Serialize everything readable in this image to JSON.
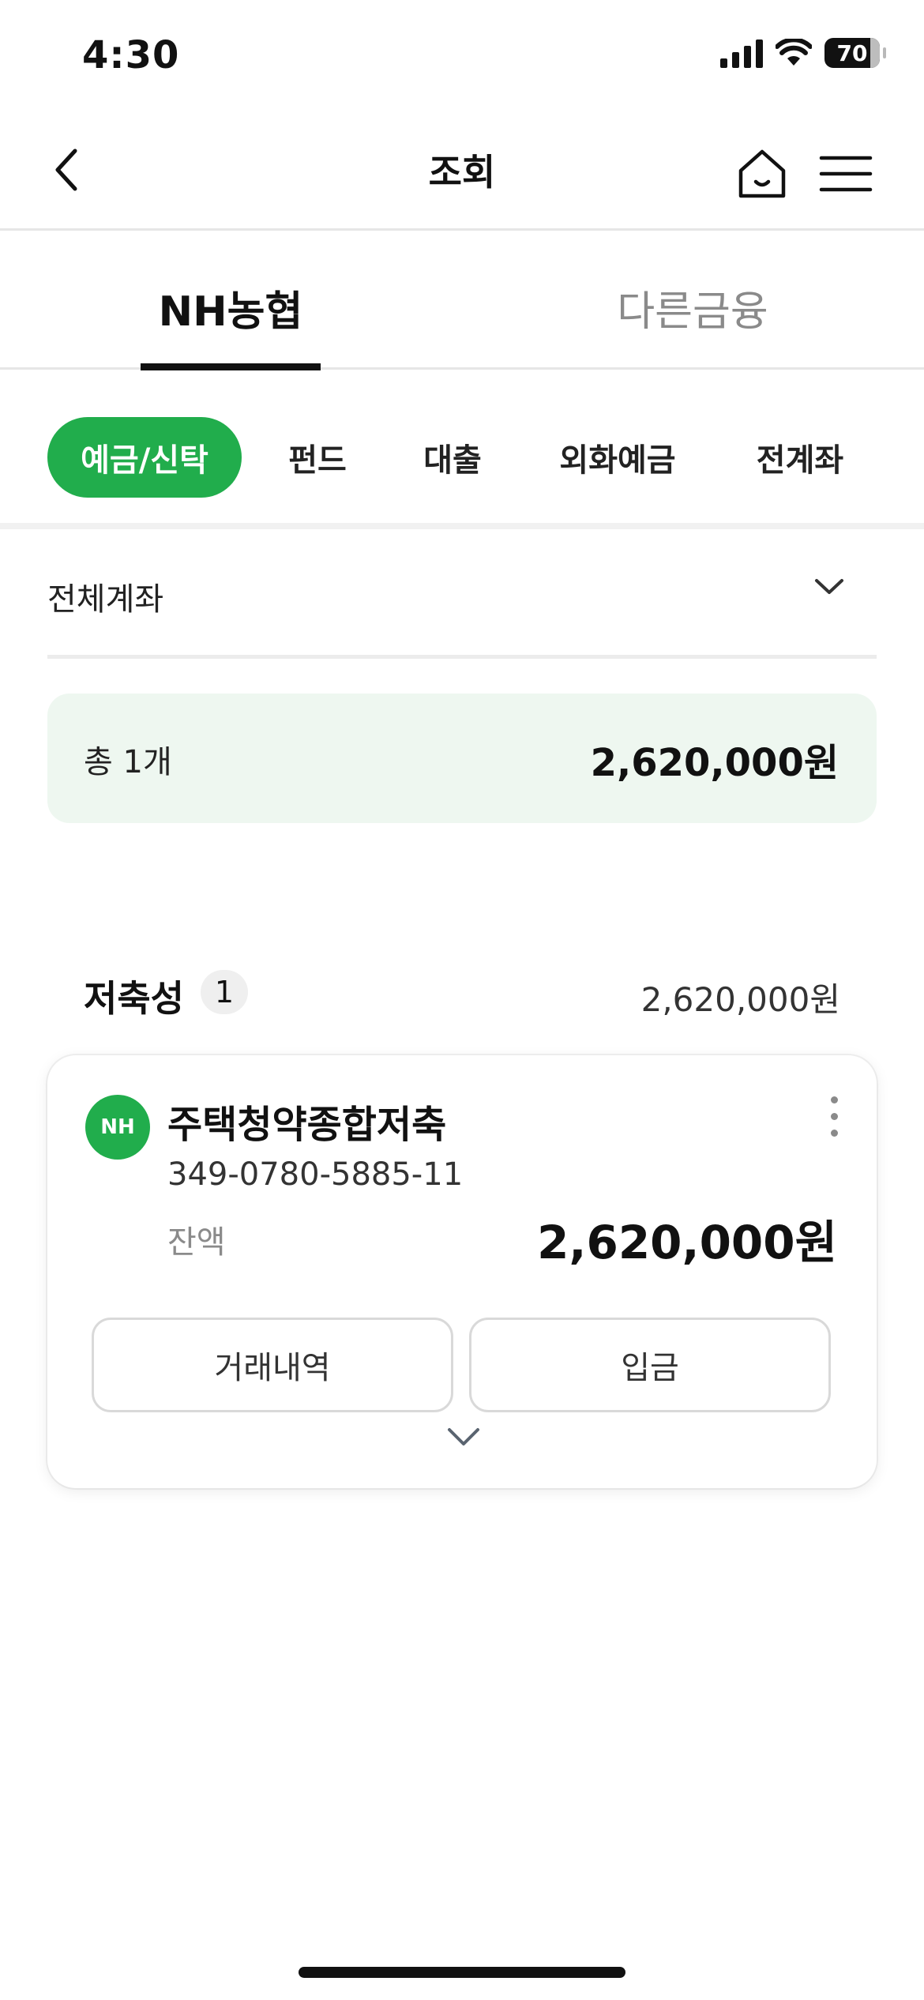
{
  "status_bar": {
    "time": "4:30",
    "battery_level": "70",
    "icons": [
      "cellular-signal-icon",
      "wifi-icon",
      "battery-icon"
    ]
  },
  "header": {
    "title": "조회",
    "back_icon": "chevron-left-icon",
    "home_icon": "home-icon",
    "menu_icon": "hamburger-menu-icon"
  },
  "top_tabs": [
    {
      "label": "NH농협",
      "active": true
    },
    {
      "label": "다른금융",
      "active": false
    }
  ],
  "category_chips": [
    {
      "label": "예금/신탁",
      "active": true
    },
    {
      "label": "펀드",
      "active": false
    },
    {
      "label": "대출",
      "active": false
    },
    {
      "label": "외화예금",
      "active": false
    },
    {
      "label": "전계좌",
      "active": false
    }
  ],
  "filter": {
    "selected": "전체계좌",
    "icon": "chevron-down-icon"
  },
  "summary": {
    "count_label": "총 1개",
    "total_amount": "2,620,000원"
  },
  "section": {
    "title": "저축성",
    "count": "1",
    "amount": "2,620,000원"
  },
  "account_card": {
    "logo_text": "NH",
    "name": "주택청약종합저축",
    "number": "349-0780-5885-11",
    "balance_label": "잔액",
    "balance": "2,620,000원",
    "buttons": {
      "history": "거래내역",
      "deposit": "입금"
    },
    "more_icon": "kebab-menu-icon",
    "expand_icon": "chevron-down-icon"
  },
  "colors": {
    "brand_green": "#21ad4c",
    "summary_bg": "#eef7f0",
    "inactive_text": "#8a8a8a"
  }
}
